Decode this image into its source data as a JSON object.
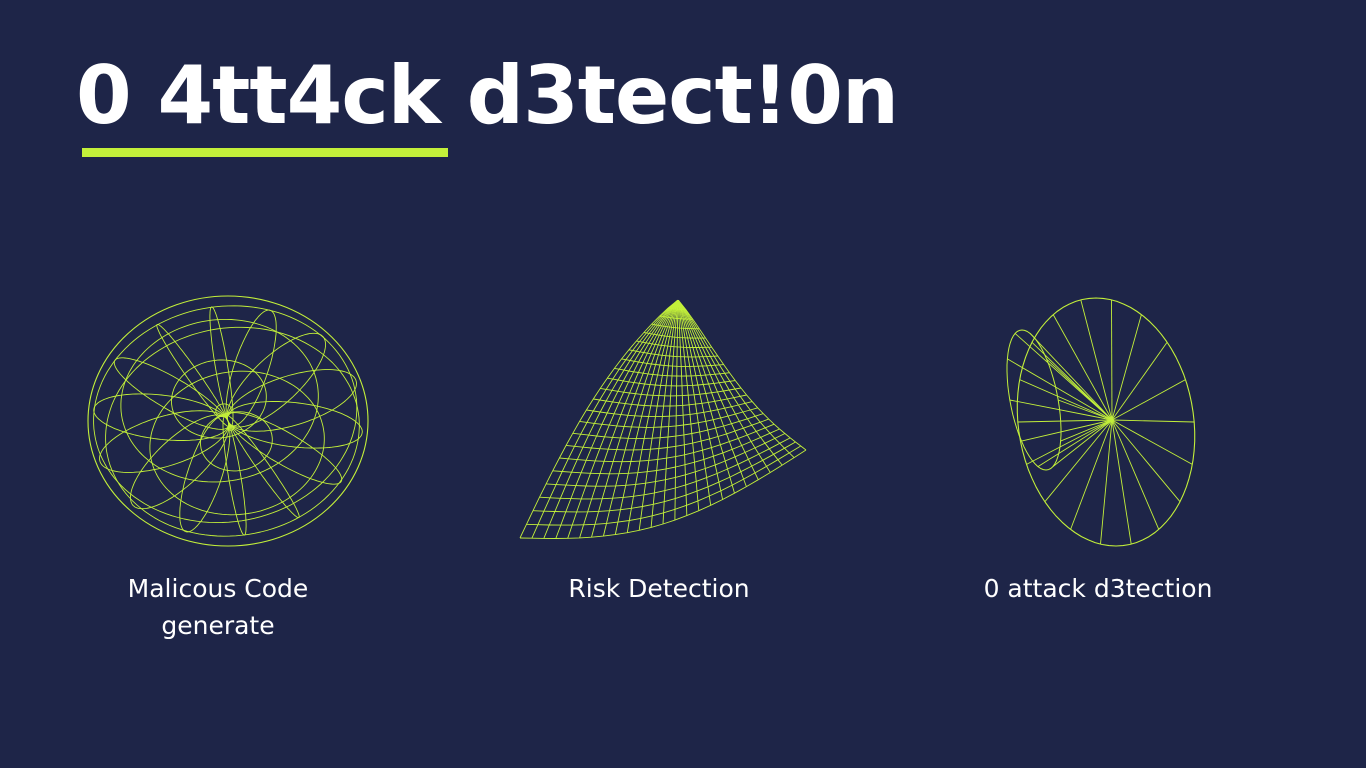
{
  "slide": {
    "title": "0 4tt4ck d3tect!0n",
    "accent_color": "#c3f03a",
    "background_color": "#1e2548",
    "items": [
      {
        "icon": "wireframe-torus-icon",
        "caption_line1": "Malicous Code",
        "caption_line2": "generate"
      },
      {
        "icon": "wireframe-surface-icon",
        "caption_line1": "Risk Detection",
        "caption_line2": ""
      },
      {
        "icon": "wireframe-cone-icon",
        "caption_line1": "0 attack d3tection",
        "caption_line2": ""
      }
    ]
  }
}
